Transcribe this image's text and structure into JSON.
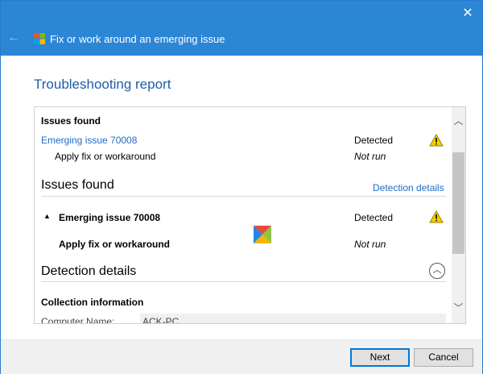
{
  "window": {
    "title": "Fix or work around an emerging issue",
    "close_glyph": "✕",
    "back_glyph": "←"
  },
  "report": {
    "heading": "Troubleshooting report",
    "summary": {
      "section_title": "Issues found",
      "issue_name": "Emerging issue 70008",
      "issue_status": "Detected",
      "fix_name": "Apply fix or workaround",
      "fix_status": "Not run"
    },
    "issues_found": {
      "section_title": "Issues found",
      "details_link": "Detection details",
      "expand_glyph": "▲",
      "issue_name": "Emerging issue 70008",
      "issue_status": "Detected",
      "fix_name": "Apply fix or workaround",
      "fix_status": "Not run"
    },
    "detection_details": {
      "section_title": "Detection details",
      "collapse_glyph": "︿",
      "collection_title": "Collection information",
      "computer_name_label": "Computer Name:",
      "computer_name_value": "ACK-PC"
    }
  },
  "buttons": {
    "next": "Next",
    "cancel": "Cancel"
  },
  "scrollbar": {
    "up_glyph": "︿",
    "down_glyph": "﹀"
  },
  "colors": {
    "titlebar": "#2b86d6",
    "heading": "#1e5ea8",
    "link": "#1f6cc6",
    "warning": "#f5d000"
  },
  "icons": {
    "title": "troubleshooter-icon",
    "warning": "warning-icon",
    "center": "troubleshooter-logo-icon"
  }
}
